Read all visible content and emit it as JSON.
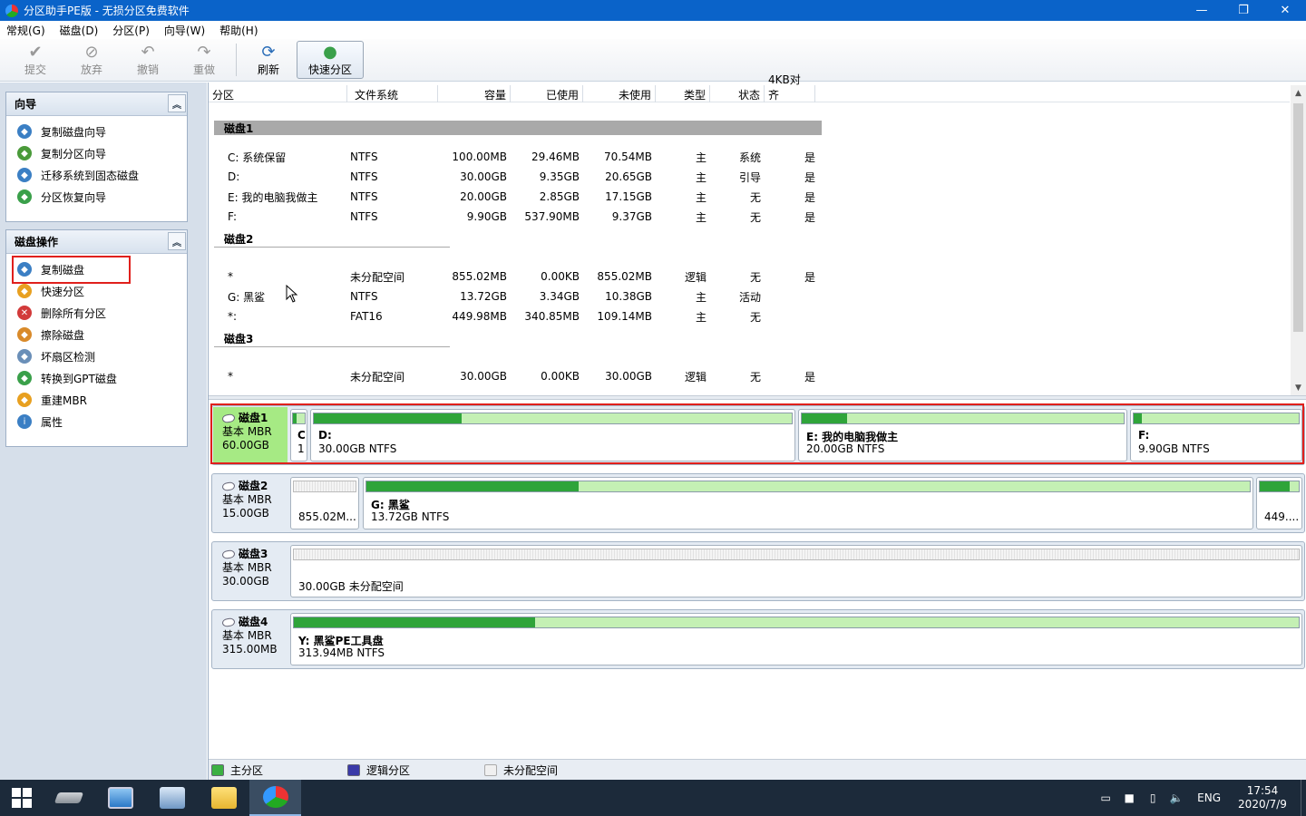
{
  "window": {
    "title": "分区助手PE版 - 无损分区免费软件",
    "controls": {
      "minimize": "—",
      "maximize": "❐",
      "close": "✕"
    }
  },
  "menu": [
    "常规(G)",
    "磁盘(D)",
    "分区(P)",
    "向导(W)",
    "帮助(H)"
  ],
  "toolbar": {
    "commit": "提交",
    "discard": "放弃",
    "undo": "撤销",
    "redo": "重做",
    "refresh": "刷新",
    "quick_partition": "快速分区"
  },
  "wizard_panel": {
    "title": "向导",
    "items": [
      "复制磁盘向导",
      "复制分区向导",
      "迁移系统到固态磁盘",
      "分区恢复向导"
    ]
  },
  "disk_ops_panel": {
    "title": "磁盘操作",
    "items": [
      "复制磁盘",
      "快速分区",
      "删除所有分区",
      "擦除磁盘",
      "坏扇区检测",
      "转换到GPT磁盘",
      "重建MBR",
      "属性"
    ]
  },
  "table": {
    "columns": [
      "分区",
      "文件系统",
      "容量",
      "已使用",
      "未使用",
      "类型",
      "状态",
      "4KB对齐"
    ],
    "disks": [
      {
        "name": "磁盘1",
        "rows": [
          [
            "C: 系统保留",
            "NTFS",
            "100.00MB",
            "29.46MB",
            "70.54MB",
            "主",
            "系统",
            "是"
          ],
          [
            "D:",
            "NTFS",
            "30.00GB",
            "9.35GB",
            "20.65GB",
            "主",
            "引导",
            "是"
          ],
          [
            "E: 我的电脑我做主",
            "NTFS",
            "20.00GB",
            "2.85GB",
            "17.15GB",
            "主",
            "无",
            "是"
          ],
          [
            "F:",
            "NTFS",
            "9.90GB",
            "537.90MB",
            "9.37GB",
            "主",
            "无",
            "是"
          ]
        ]
      },
      {
        "name": "磁盘2",
        "rows": [
          [
            "*",
            "未分配空间",
            "855.02MB",
            "0.00KB",
            "855.02MB",
            "逻辑",
            "无",
            "是"
          ],
          [
            "G: 黑鲨",
            "NTFS",
            "13.72GB",
            "3.34GB",
            "10.38GB",
            "主",
            "活动",
            ""
          ],
          [
            "*:",
            "FAT16",
            "449.98MB",
            "340.85MB",
            "109.14MB",
            "主",
            "无",
            ""
          ]
        ]
      },
      {
        "name": "磁盘3",
        "rows": [
          [
            "*",
            "未分配空间",
            "30.00GB",
            "0.00KB",
            "30.00GB",
            "逻辑",
            "无",
            "是"
          ]
        ]
      }
    ]
  },
  "diskmap": [
    {
      "name": "磁盘1",
      "type": "基本 MBR",
      "size": "60.00GB",
      "partitions": [
        {
          "label": "C",
          "size": "1",
          "used_fraction": 0.3
        },
        {
          "label": "D:",
          "size": "30.00GB NTFS",
          "used_fraction": 0.31
        },
        {
          "label": "E: 我的电脑我做主",
          "size": "20.00GB NTFS",
          "used_fraction": 0.14
        },
        {
          "label": "F:",
          "size": "9.90GB NTFS",
          "used_fraction": 0.05
        }
      ]
    },
    {
      "name": "磁盘2",
      "type": "基本 MBR",
      "size": "15.00GB",
      "partitions": [
        {
          "label": "",
          "size": "855.02M...",
          "used_fraction": 0,
          "unallocated": true
        },
        {
          "label": "G: 黑鲨",
          "size": "13.72GB NTFS",
          "used_fraction": 0.24
        },
        {
          "label": "",
          "size": "449....",
          "used_fraction": 0.76
        }
      ]
    },
    {
      "name": "磁盘3",
      "type": "基本 MBR",
      "size": "30.00GB",
      "partitions": [
        {
          "label": "",
          "size": "30.00GB 未分配空间",
          "used_fraction": 0,
          "unallocated": true
        }
      ]
    },
    {
      "name": "磁盘4",
      "type": "基本 MBR",
      "size": "315.00MB",
      "partitions": [
        {
          "label": "Y: 黑鲨PE工具盘",
          "size": "313.94MB NTFS",
          "used_fraction": 0.24
        }
      ]
    }
  ],
  "legend": {
    "primary": "主分区",
    "logical": "逻辑分区",
    "unallocated": "未分配空间",
    "colors": {
      "primary": "#3cb043",
      "logical": "#3a3aa8",
      "unallocated": "#f0f0f0"
    }
  },
  "taskbar": {
    "lang": "ENG",
    "time": "17:54",
    "date": "2020/7/9"
  }
}
